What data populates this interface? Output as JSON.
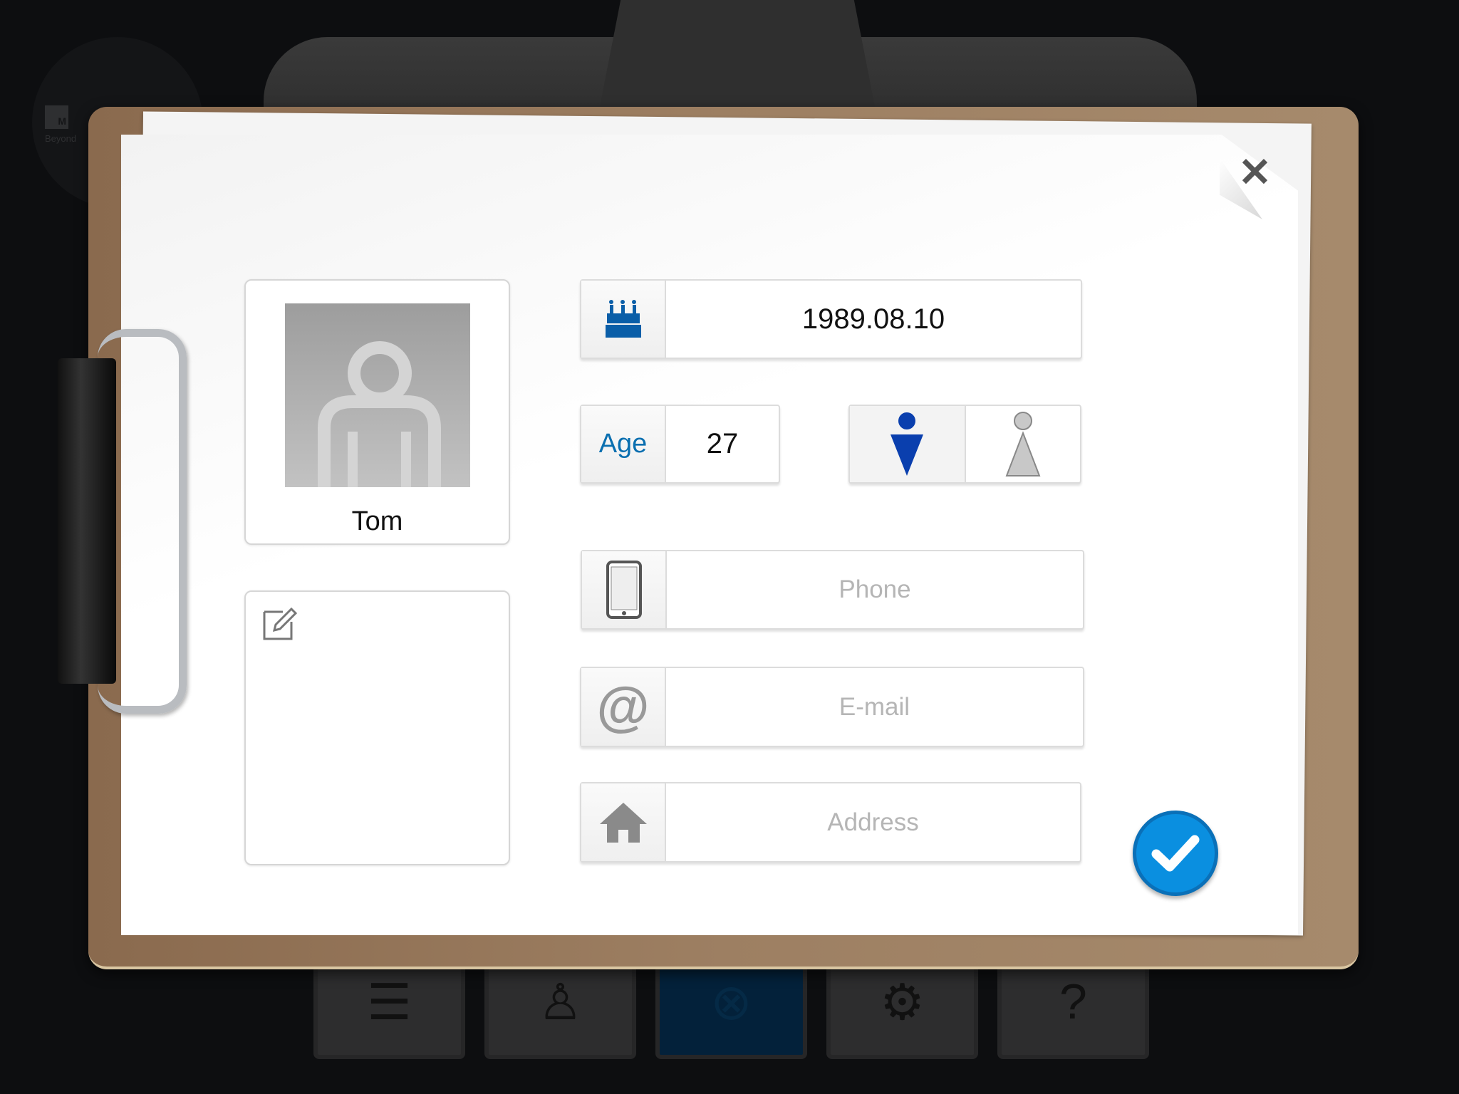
{
  "logo": {
    "mark": "M",
    "tagline": "Beyond"
  },
  "profile": {
    "name": "Tom",
    "birthday": "1989.08.10",
    "age_label": "Age",
    "age": "27",
    "gender_selected": "male"
  },
  "fields": {
    "phone_placeholder": "Phone",
    "email_placeholder": "E-mail",
    "address_placeholder": "Address",
    "phone": "",
    "email": "",
    "address": ""
  },
  "colors": {
    "accent": "#0a8fe0",
    "male": "#0a3fae",
    "female": "#c8c8c8",
    "birthday_icon": "#0a5ea8"
  },
  "toolbar": [
    "list-edit-icon",
    "person-icon",
    "search-analysis-icon",
    "tools-gear-icon",
    "help-search-icon"
  ],
  "toolbar_active": 2
}
